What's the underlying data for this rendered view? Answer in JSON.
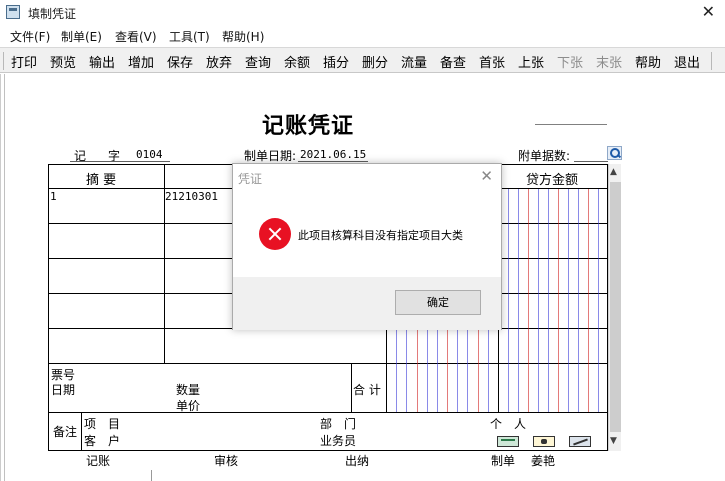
{
  "window": {
    "title": "填制凭证",
    "close_glyph": "✕"
  },
  "menu": [
    "文件(F)",
    "制单(E)",
    "查看(V)",
    "工具(T)",
    "帮助(H)"
  ],
  "toolbar": [
    {
      "label": "打印",
      "enabled": true
    },
    {
      "label": "预览",
      "enabled": true
    },
    {
      "label": "输出",
      "enabled": true
    },
    {
      "label": "增加",
      "enabled": true
    },
    {
      "label": "保存",
      "enabled": true
    },
    {
      "label": "放弃",
      "enabled": true
    },
    {
      "label": "查询",
      "enabled": true
    },
    {
      "label": "余额",
      "enabled": true
    },
    {
      "label": "插分",
      "enabled": true
    },
    {
      "label": "删分",
      "enabled": true
    },
    {
      "label": "流量",
      "enabled": true
    },
    {
      "label": "备查",
      "enabled": true
    },
    {
      "label": "首张",
      "enabled": true
    },
    {
      "label": "上张",
      "enabled": true
    },
    {
      "label": "下张",
      "enabled": false
    },
    {
      "label": "末张",
      "enabled": false
    },
    {
      "label": "帮助",
      "enabled": true
    },
    {
      "label": "退出",
      "enabled": true
    }
  ],
  "voucher": {
    "title": "记账凭证",
    "type_label": "记",
    "zi_label": "字",
    "number": "0104",
    "date_label": "制单日期:",
    "date": "2021.06.15",
    "attachments_label": "附单据数:",
    "col_summary": "摘 要",
    "col_credit": "贷方金额",
    "row1_summary": "1",
    "row1_account": "21210301",
    "ticket_label": "票号",
    "date_row_label": "日期",
    "qty_label": "数量",
    "price_label": "单价",
    "total_label": "合 计",
    "memo_label": "备注",
    "project_label": "项　目",
    "customer_label": "客　户",
    "dept_label": "部　门",
    "person_label": "个　人",
    "salesman_label": "业务员",
    "footer_bookkeeping": "记账",
    "footer_audit": "审核",
    "footer_cashier": "出纳",
    "footer_preparer": "制单",
    "preparer_name": "姜艳"
  },
  "dialog": {
    "title": "凭证",
    "message": "此项目核算科目没有指定项目大类",
    "ok": "确定",
    "close_glyph": "✕"
  },
  "colors": {
    "grid_blue": "#3b3bd8",
    "grid_red": "#d02020",
    "error_red": "#e81123"
  }
}
